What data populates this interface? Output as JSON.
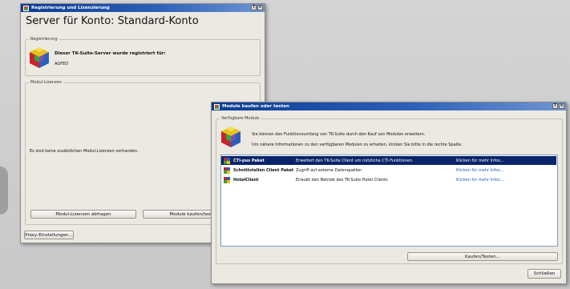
{
  "main_window": {
    "title": "Registrierung und Lizenzierung",
    "heading": "Server für Konto: Standard-Konto",
    "registrierung": {
      "label": "Registrierung",
      "status_text": "Dieser TK-Suite-Server wurde registriert für:",
      "company": "AGFEO"
    },
    "modul_lizenzen": {
      "label": "Modul-Lizenzen",
      "empty_text": "Es sind keine zusätzlichen Modul-Lizenzen vorhanden.",
      "btn_abfragen": "Modul-Lizenzen abfragen",
      "btn_kaufen": "Module kaufen/testen..."
    },
    "btn_proxy": "Proxy-Einstellungen..."
  },
  "dialog": {
    "title": "Module kaufen oder testen",
    "group_label": "Verfügbare Module",
    "info_line1": "Sie können den Funktionsumfang von TK-Suite durch den Kauf von Modulen erweitern.",
    "info_line2": "Um nähere Informationen zu den verfügbaren Modulen zu erhalten, klicken Sie bitte in die rechte Spalte.",
    "modules": [
      {
        "name": "CTI-pus Paket",
        "description": "Erweitert den TK-Suite Client um nützliche CTI-Funktionen.",
        "link": "Klicken für mehr Infos...",
        "selected": true
      },
      {
        "name": "Schnittstellen Client Paket",
        "description": "Zugriff auf externe Datenquellen",
        "link": "Klicken für mehr Infos...",
        "selected": false
      },
      {
        "name": "HotelClient",
        "description": "Erlaubt den Betrieb des TK-Suite Hotel Clients",
        "link": "Klicken für mehr Infos...",
        "selected": false
      }
    ],
    "btn_kaufen": "Kaufen/Testen...",
    "btn_close": "Schließen"
  },
  "icons": {
    "cube": "cube-logo-icon",
    "close": "close-icon",
    "help": "help-icon"
  },
  "colors": {
    "titlebar": "#0b3c93",
    "selection": "#0a246a",
    "link": "#2a5fb8"
  }
}
